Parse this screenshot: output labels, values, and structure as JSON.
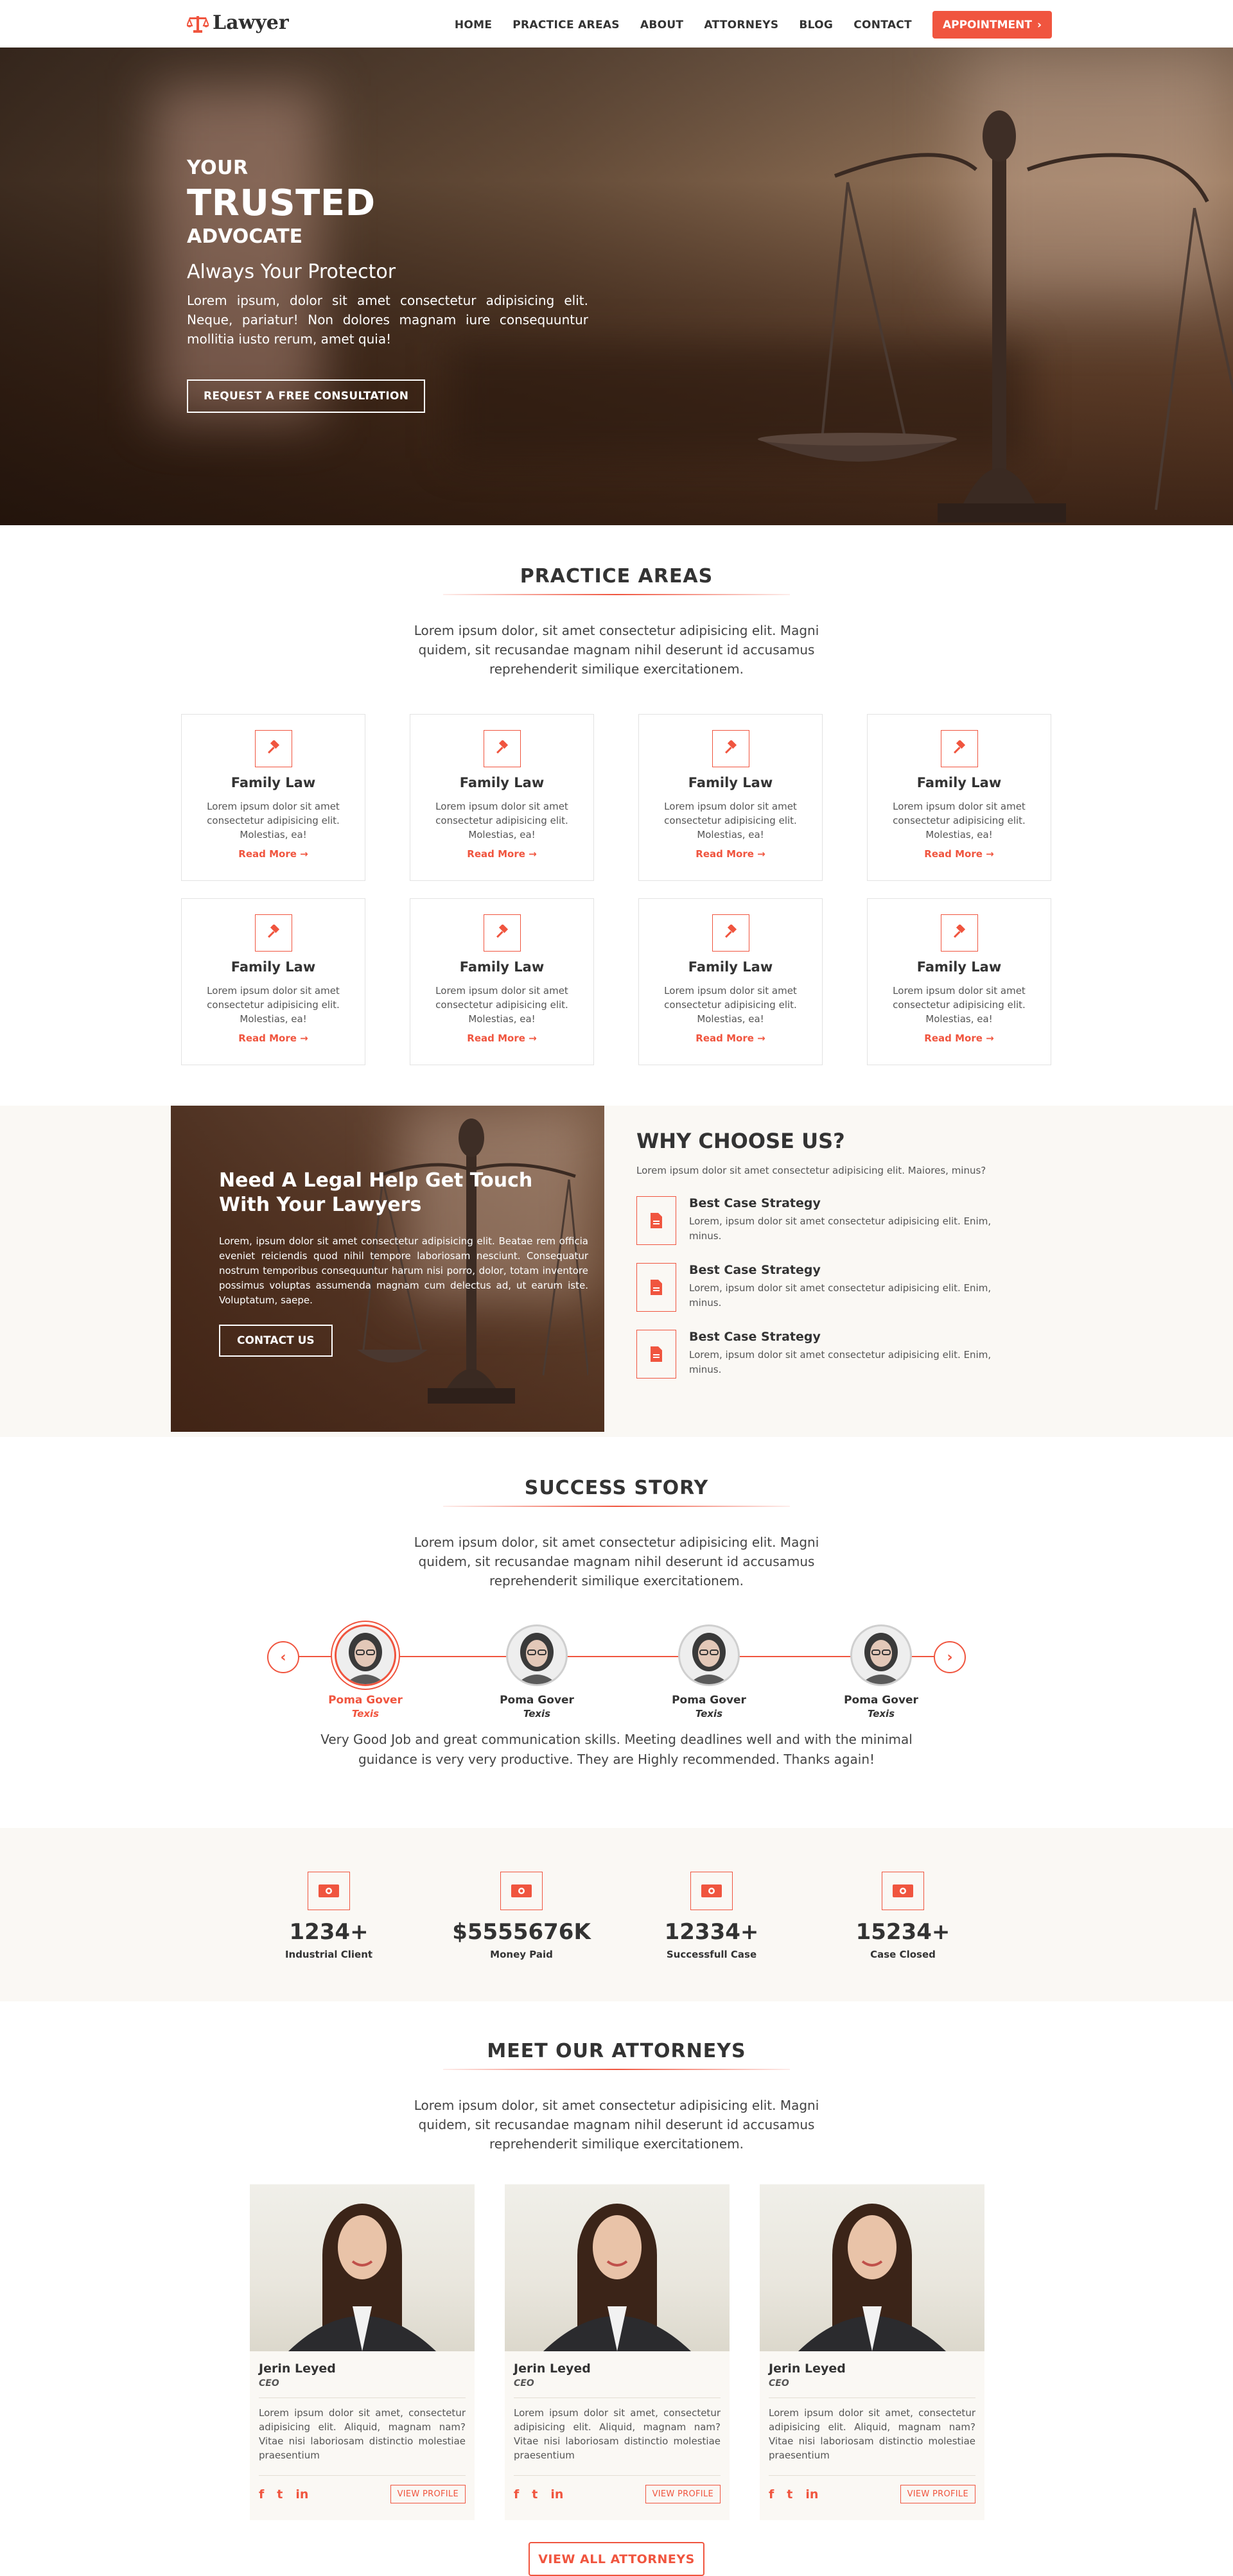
{
  "nav": {
    "logo_text": "Lawyer",
    "items": [
      {
        "label": "HOME"
      },
      {
        "label": "PRACTICE AREAS"
      },
      {
        "label": "ABOUT"
      },
      {
        "label": "ATTORNEYS"
      },
      {
        "label": "BLOG"
      },
      {
        "label": "CONTACT"
      }
    ],
    "appointment_label": "APPOINTMENT"
  },
  "hero": {
    "kicker": "YOUR",
    "title": "TRUSTED",
    "subtitle": "ADVOCATE",
    "tagline": "Always Your Protector",
    "text": "Lorem ipsum, dolor sit amet consectetur adipisicing elit. Neque, pariatur! Non dolores magnam iure consequuntur mollitia iusto rerum, amet quia!",
    "button": "REQUEST A FREE CONSULTATION"
  },
  "practice": {
    "title": "PRACTICE AREAS",
    "desc": "Lorem ipsum dolor, sit amet consectetur adipisicing elit. Magni quidem, sit recusandae magnam nihil deserunt id accusamus reprehenderit similique exercitationem.",
    "cards": [
      {
        "title": "Family Law",
        "text": "Lorem ipsum dolor sit amet consectetur adipisicing elit. Molestias, ea!",
        "link": "Read More →"
      },
      {
        "title": "Family Law",
        "text": "Lorem ipsum dolor sit amet consectetur adipisicing elit. Molestias, ea!",
        "link": "Read More →"
      },
      {
        "title": "Family Law",
        "text": "Lorem ipsum dolor sit amet consectetur adipisicing elit. Molestias, ea!",
        "link": "Read More →"
      },
      {
        "title": "Family Law",
        "text": "Lorem ipsum dolor sit amet consectetur adipisicing elit. Molestias, ea!",
        "link": "Read More →"
      },
      {
        "title": "Family Law",
        "text": "Lorem ipsum dolor sit amet consectetur adipisicing elit. Molestias, ea!",
        "link": "Read More →"
      },
      {
        "title": "Family Law",
        "text": "Lorem ipsum dolor sit amet consectetur adipisicing elit. Molestias, ea!",
        "link": "Read More →"
      },
      {
        "title": "Family Law",
        "text": "Lorem ipsum dolor sit amet consectetur adipisicing elit. Molestias, ea!",
        "link": "Read More →"
      },
      {
        "title": "Family Law",
        "text": "Lorem ipsum dolor sit amet consectetur adipisicing elit. Molestias, ea!",
        "link": "Read More →"
      }
    ]
  },
  "legal_help": {
    "title": "Need A Legal Help Get Touch With Your Lawyers",
    "text": "Lorem, ipsum dolor sit amet consectetur adipisicing elit. Beatae rem officia eveniet reiciendis quod nihil tempore laboriosam nesciunt. Consequatur nostrum temporibus consequuntur harum nisi porro, dolor, totam inventore possimus voluptas assumenda magnam cum delectus ad, ut earum iste. Voluptatum, saepe.",
    "button": "CONTACT US"
  },
  "why": {
    "title": "WHY CHOOSE US?",
    "desc": "Lorem ipsum dolor sit amet consectetur adipisicing elit. Maiores, minus?",
    "items": [
      {
        "title": "Best Case Strategy",
        "text": "Lorem, ipsum dolor sit amet consectetur adipisicing elit. Enim, minus."
      },
      {
        "title": "Best Case Strategy",
        "text": "Lorem, ipsum dolor sit amet consectetur adipisicing elit. Enim, minus."
      },
      {
        "title": "Best Case Strategy",
        "text": "Lorem, ipsum dolor sit amet consectetur adipisicing elit. Enim, minus."
      }
    ]
  },
  "success": {
    "title": "SUCCESS STORY",
    "desc": "Lorem ipsum dolor, sit amet consectetur adipisicing elit. Magni quidem, sit recusandae magnam nihil deserunt id accusamus reprehenderit similique exercitationem.",
    "people": [
      {
        "name": "Poma Gover",
        "location": "Texis"
      },
      {
        "name": "Poma Gover",
        "location": "Texis"
      },
      {
        "name": "Poma Gover",
        "location": "Texis"
      },
      {
        "name": "Poma Gover",
        "location": "Texis"
      }
    ],
    "testimonial": "Very Good Job and great communication skills. Meeting deadlines well and with the minimal guidance is very very productive. They are Highly recommended. Thanks again!"
  },
  "stats": [
    {
      "value": "1234+",
      "label": "Industrial Client"
    },
    {
      "value": "$5555676K",
      "label": "Money Paid"
    },
    {
      "value": "12334+",
      "label": "Successfull Case"
    },
    {
      "value": "15234+",
      "label": "Case Closed"
    }
  ],
  "attorneys": {
    "title": "MEET OUR ATTORNEYS",
    "desc": "Lorem ipsum dolor, sit amet consectetur adipisicing elit. Magni quidem, sit recusandae magnam nihil deserunt id accusamus reprehenderit similique exercitationem.",
    "cards": [
      {
        "name": "Jerin Leyed",
        "role": "CEO",
        "text": "Lorem ipsum dolor sit amet, consectetur adipisicing elit. Aliquid, magnam nam? Vitae nisi laboriosam distinctio molestiae praesentium",
        "button": "VIEW PROFILE"
      },
      {
        "name": "Jerin Leyed",
        "role": "CEO",
        "text": "Lorem ipsum dolor sit amet, consectetur adipisicing elit. Aliquid, magnam nam? Vitae nisi laboriosam distinctio molestiae praesentium",
        "button": "VIEW PROFILE"
      },
      {
        "name": "Jerin Leyed",
        "role": "CEO",
        "text": "Lorem ipsum dolor sit amet, consectetur adipisicing elit. Aliquid, magnam nam? Vitae nisi laboriosam distinctio molestiae praesentium",
        "button": "VIEW PROFILE"
      }
    ],
    "view_all": "VIEW ALL ATTORNEYS"
  },
  "socials": {
    "facebook": "f",
    "twitter": "t",
    "linkedin": "in"
  },
  "colors": {
    "accent": "#f0553f",
    "section_bg": "#faf8f4",
    "text": "#333333"
  }
}
